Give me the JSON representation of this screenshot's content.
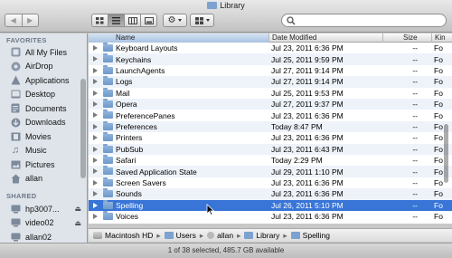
{
  "window": {
    "title": "Library"
  },
  "toolbar": {
    "back_icon": "back-arrow-icon",
    "forward_icon": "forward-arrow-icon",
    "views": [
      "icon-view",
      "list-view",
      "column-view",
      "coverflow-view"
    ],
    "active_view": "list-view",
    "action_icon": "gear-icon",
    "arrange_icon": "arrange-grid-icon",
    "search": {
      "placeholder": "",
      "value": ""
    }
  },
  "sidebar": {
    "favorites_header": "FAVORITES",
    "favorites": [
      {
        "label": "All My Files",
        "icon": "all-files-icon"
      },
      {
        "label": "AirDrop",
        "icon": "airdrop-icon"
      },
      {
        "label": "Applications",
        "icon": "applications-icon"
      },
      {
        "label": "Desktop",
        "icon": "desktop-icon"
      },
      {
        "label": "Documents",
        "icon": "documents-icon"
      },
      {
        "label": "Downloads",
        "icon": "downloads-icon"
      },
      {
        "label": "Movies",
        "icon": "movies-icon"
      },
      {
        "label": "Music",
        "icon": "music-icon"
      },
      {
        "label": "Pictures",
        "icon": "pictures-icon"
      },
      {
        "label": "allan",
        "icon": "home-icon"
      }
    ],
    "shared_header": "SHARED",
    "shared": [
      {
        "label": "hp3007...",
        "icon": "computer-icon"
      },
      {
        "label": "video02",
        "icon": "computer-icon"
      },
      {
        "label": "allan02",
        "icon": "computer-icon"
      }
    ]
  },
  "columns": {
    "name": "Name",
    "date": "Date Modified",
    "size": "Size",
    "kind": "Kin"
  },
  "files": [
    {
      "name": "Keyboard Layouts",
      "date": "Jul 23, 2011 6:36 PM",
      "size": "--",
      "kind": "Fo"
    },
    {
      "name": "Keychains",
      "date": "Jul 25, 2011 9:59 PM",
      "size": "--",
      "kind": "Fo"
    },
    {
      "name": "LaunchAgents",
      "date": "Jul 27, 2011 9:14 PM",
      "size": "--",
      "kind": "Fo"
    },
    {
      "name": "Logs",
      "date": "Jul 27, 2011 9:14 PM",
      "size": "--",
      "kind": "Fo"
    },
    {
      "name": "Mail",
      "date": "Jul 25, 2011 9:53 PM",
      "size": "--",
      "kind": "Fo"
    },
    {
      "name": "Opera",
      "date": "Jul 27, 2011 9:37 PM",
      "size": "--",
      "kind": "Fo"
    },
    {
      "name": "PreferencePanes",
      "date": "Jul 23, 2011 6:36 PM",
      "size": "--",
      "kind": "Fo"
    },
    {
      "name": "Preferences",
      "date": "Today 8:47 PM",
      "size": "--",
      "kind": "Fo"
    },
    {
      "name": "Printers",
      "date": "Jul 23, 2011 6:36 PM",
      "size": "--",
      "kind": "Fo"
    },
    {
      "name": "PubSub",
      "date": "Jul 23, 2011 6:43 PM",
      "size": "--",
      "kind": "Fo"
    },
    {
      "name": "Safari",
      "date": "Today 2:29 PM",
      "size": "--",
      "kind": "Fo"
    },
    {
      "name": "Saved Application State",
      "date": "Jul 29, 2011 1:10 PM",
      "size": "--",
      "kind": "Fo"
    },
    {
      "name": "Screen Savers",
      "date": "Jul 23, 2011 6:36 PM",
      "size": "--",
      "kind": "Fo"
    },
    {
      "name": "Sounds",
      "date": "Jul 23, 2011 6:36 PM",
      "size": "--",
      "kind": "Fo"
    },
    {
      "name": "Spelling",
      "date": "Jul 26, 2011 5:10 PM",
      "size": "--",
      "kind": "Fo",
      "selected": true
    },
    {
      "name": "Voices",
      "date": "Jul 23, 2011 6:36 PM",
      "size": "--",
      "kind": "Fo"
    }
  ],
  "pathbar": [
    {
      "label": "Macintosh HD",
      "icon": "hard-drive-icon"
    },
    {
      "label": "Users",
      "icon": "folder-icon"
    },
    {
      "label": "allan",
      "icon": "home-icon"
    },
    {
      "label": "Library",
      "icon": "folder-icon"
    },
    {
      "label": "Spelling",
      "icon": "folder-icon"
    }
  ],
  "status": {
    "text": "1 of 38 selected, 485.7 GB available"
  },
  "colors": {
    "selection": "#3875d7",
    "sidebar": "#dee4ea",
    "alt_row": "#eef3fa"
  }
}
